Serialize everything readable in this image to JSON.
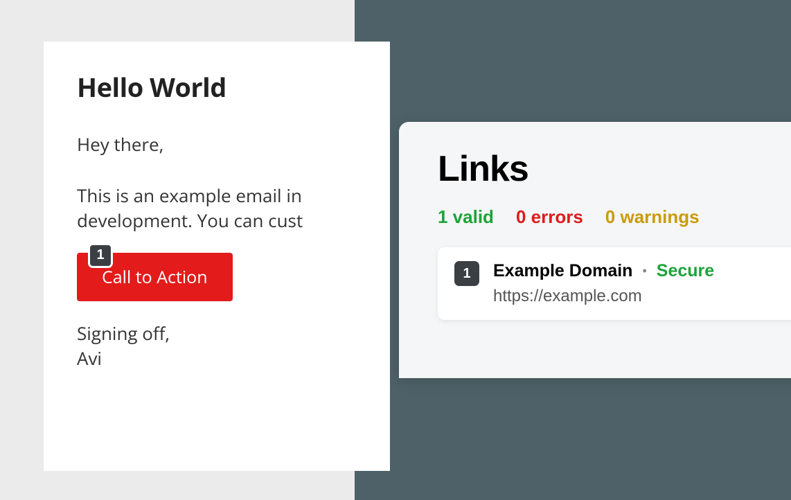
{
  "email": {
    "title": "Hello World",
    "greeting": "Hey there,",
    "body_line1": "This is an example email in",
    "body_line2": "development. You can cust",
    "cta_label": "Call to Action",
    "cta_badge": "1",
    "signoff_line1": "Signing off,",
    "signoff_line2": "Avi"
  },
  "links": {
    "title": "Links",
    "stats": {
      "valid": "1 valid",
      "errors": "0 errors",
      "warnings": "0 warnings"
    },
    "items": [
      {
        "badge": "1",
        "domain": "Example Domain",
        "status": "Secure",
        "url": "https://example.com"
      }
    ]
  }
}
